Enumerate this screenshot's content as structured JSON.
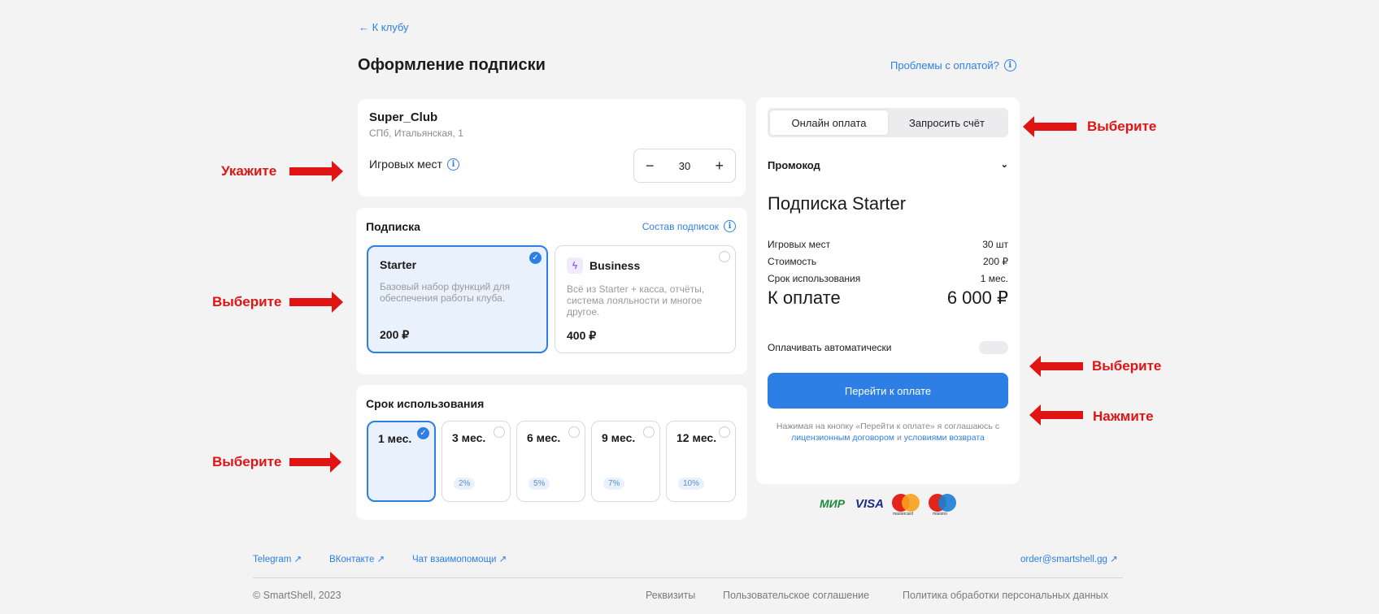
{
  "back_link": "← К клубу",
  "page_title": "Оформление подписки",
  "problems_link": "Проблемы с оплатой?",
  "club": {
    "name": "Super_Club",
    "address": "СПб, Итальянская, 1",
    "seats_label": "Игровых мест",
    "seats_value": "30",
    "minus": "−",
    "plus": "+"
  },
  "subscription": {
    "heading": "Подписка",
    "composition_link": "Состав подписок",
    "plans": [
      {
        "name": "Starter",
        "description": "Базовый набор функций для обеспечения работы клуба.",
        "price": "200 ₽",
        "selected": true
      },
      {
        "name": "Business",
        "description": "Всё из Starter + касса, отчёты, система лояльности и многое другое.",
        "price": "400 ₽",
        "selected": false
      }
    ]
  },
  "term": {
    "heading": "Срок использования",
    "options": [
      {
        "label": "1 мес.",
        "discount": "",
        "selected": true
      },
      {
        "label": "3 мес.",
        "discount": "2%",
        "selected": false
      },
      {
        "label": "6 мес.",
        "discount": "5%",
        "selected": false
      },
      {
        "label": "9 мес.",
        "discount": "7%",
        "selected": false
      },
      {
        "label": "12 мес.",
        "discount": "10%",
        "selected": false
      }
    ]
  },
  "payment": {
    "tabs": [
      {
        "label": "Онлайн оплата",
        "active": true
      },
      {
        "label": "Запросить счёт",
        "active": false
      }
    ],
    "promo_label": "Промокод",
    "summary_title": "Подписка Starter",
    "rows": [
      {
        "label": "Игровых мест",
        "value": "30 шт"
      },
      {
        "label": "Стоимость",
        "value": "200 ₽"
      },
      {
        "label": "Срок использования",
        "value": "1 мес."
      }
    ],
    "total_label": "К оплате",
    "total_value": "6 000 ₽",
    "auto_pay_label": "Оплачивать автоматически",
    "pay_button": "Перейти к оплате",
    "note_pre": "Нажимая на кнопку «Перейти к оплате» я соглашаюсь с",
    "note_link1": "лицензионным договором",
    "note_and": "и",
    "note_link2": "условиями возврата"
  },
  "card_logos": {
    "mir": "МИР",
    "visa": "VISA",
    "mastercard": "mastercard",
    "maestro": "maestro"
  },
  "annotations": {
    "specify": "Укажите",
    "choose1": "Выберите",
    "choose2": "Выберите",
    "choose3": "Выберите",
    "choose4": "Выберите",
    "press": "Нажмите"
  },
  "footer": {
    "telegram": "Telegram ↗",
    "vk": "ВКонтакте ↗",
    "chat": "Чат взаимопомощи ↗",
    "email": "order@smartshell.gg ↗",
    "copyright": "© SmartShell, 2023",
    "requisites": "Реквизиты",
    "agreement": "Пользовательское соглашение",
    "privacy": "Политика обработки персональных данных"
  },
  "colors": {
    "accent": "#2d7fe6",
    "annotation": "#e11414",
    "background": "#f3f3f4"
  }
}
